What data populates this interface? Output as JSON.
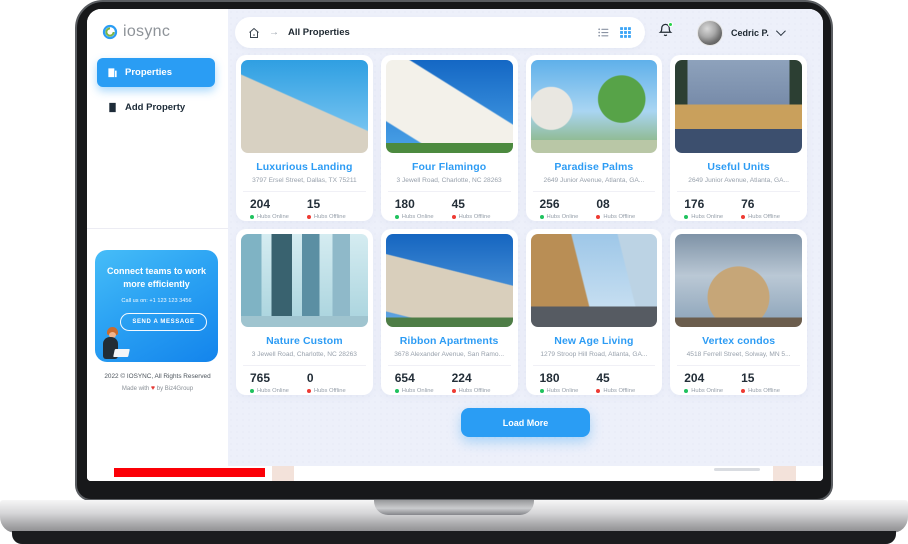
{
  "app": {
    "logo": "iosync"
  },
  "header": {
    "breadcrumb_current": "All Properties",
    "user_name": "Cedric P."
  },
  "sidebar": {
    "nav": [
      {
        "label": "Properties"
      },
      {
        "label": "Add Property"
      }
    ],
    "promo": {
      "title": "Connect teams to work more efficiently",
      "phone": "Call us on: +1 123 123 3456",
      "cta": "SEND A MESSAGE"
    },
    "copyright": "2022 © IOSYNC, All Rights Reserved",
    "made_with": "Made with",
    "heart_icon": "♥",
    "made_by": "by Biz4Group"
  },
  "labels": {
    "hubs_online": "Hubs Online",
    "hubs_offline": "Hubs Offline",
    "load_more": "Load More"
  },
  "properties": [
    {
      "name": "Luxurious Landing",
      "address": "3797 Ersel Street, Dallas, TX 75211",
      "hubs_online": "204",
      "hubs_offline": "15"
    },
    {
      "name": "Four Flamingo",
      "address": "3 Jewell Road, Charlotte, NC 28263",
      "hubs_online": "180",
      "hubs_offline": "45"
    },
    {
      "name": "Paradise Palms",
      "address": "2649 Junior Avenue, Atlanta, GA...",
      "hubs_online": "256",
      "hubs_offline": "08"
    },
    {
      "name": "Useful Units",
      "address": "2649 Junior Avenue, Atlanta, GA...",
      "hubs_online": "176",
      "hubs_offline": "76"
    },
    {
      "name": "Nature Custom",
      "address": "3 Jewell Road, Charlotte, NC 28263",
      "hubs_online": "765",
      "hubs_offline": "0"
    },
    {
      "name": "Ribbon Apartments",
      "address": "3678 Alexander Avenue, San Ramo...",
      "hubs_online": "654",
      "hubs_offline": "224"
    },
    {
      "name": "New Age Living",
      "address": "1279 Stroop Hill Road, Atlanta, GA...",
      "hubs_online": "180",
      "hubs_offline": "45"
    },
    {
      "name": "Vertex condos",
      "address": "4518 Ferrell Street, Solway, MN 5...",
      "hubs_online": "204",
      "hubs_offline": "15"
    }
  ],
  "colors": {
    "accent": "#2a9df4",
    "online": "#1fc25e",
    "offline": "#ee3b33",
    "main_bg": "#edf0fa",
    "red_bar": "#fb0007",
    "promo_gradient_from": "#46bdf8",
    "promo_gradient_to": "#1384ec"
  }
}
